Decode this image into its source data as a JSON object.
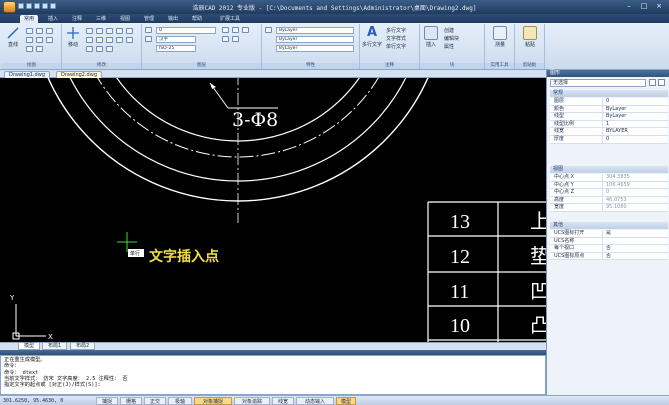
{
  "title": "浩辰CAD 2012 专业版 - [C:\\Documents and Settings\\Administrator\\桌面\\Drawing2.dwg]",
  "ribbon_tabs": [
    "常用",
    "插入",
    "注释",
    "三维",
    "视图",
    "管理",
    "输出",
    "帮助",
    "扩展工具"
  ],
  "active_tab": "常用",
  "ribbon": {
    "draw_group": "绘图",
    "line_btn": "直线",
    "modify_group": "修改",
    "move_btn": "移动",
    "layer_group": "图层",
    "layer_value": "0",
    "color_value": "ByLayer",
    "linetype_value": "ByLayer",
    "lineweight_value": "ByLayer",
    "props_group": "特性",
    "text_style": "汉字",
    "dim_style": "ISO-25",
    "annot_group": "注释",
    "mtext_btn": "多行文字",
    "mtext_style": "多行文字",
    "text_style_btn": "文字样式",
    "single_text": "单行文字",
    "block_group": "块",
    "insert_btn": "插入",
    "create_btn": "创建",
    "edit_block": "编辑块",
    "attr": "属性",
    "utility_group": "实用工具",
    "measure_btn": "测量",
    "clip_btn": "剪贴板",
    "paste_btn": "粘贴"
  },
  "doc_tabs": [
    "Drawing1.dwg",
    "Drawing2.dwg"
  ],
  "canvas": {
    "dim_text": "3-Φ8",
    "insert_label": "文字插入点",
    "cursor_tag": "单行",
    "table_numbers": [
      "13",
      "12",
      "11",
      "10"
    ],
    "table_right": [
      "上",
      "垫",
      "凹",
      "凸"
    ]
  },
  "layout_tabs": [
    "模型",
    "布局1",
    "布局2"
  ],
  "command_lines": [
    "正在重生成模型。",
    "命令：",
    "命令：_dtext",
    "当前文字样式： 仿宋   文字高度： 2.5  注释性： 否",
    "指定文字的起点或 [对正(J)/样式(S)]:"
  ],
  "status": {
    "coords": "301.6250, 95.4630, 0",
    "buttons": [
      "捕捉",
      "栅格",
      "正交",
      "极轴",
      "对象捕捉",
      "对象追踪",
      "线宽",
      "动态输入",
      "模型"
    ],
    "on_buttons": [
      "对象捕捉",
      "模型"
    ]
  },
  "properties": {
    "header": "图形",
    "selection": "无选择",
    "sections": {
      "general": "常规",
      "view": "视图",
      "misc": "其他"
    },
    "general_rows": [
      {
        "k": "图层",
        "v": "0"
      },
      {
        "k": "颜色",
        "v": "ByLayer"
      },
      {
        "k": "线型",
        "v": "ByLayer"
      },
      {
        "k": "线型比例",
        "v": "1"
      },
      {
        "k": "线宽",
        "v": "BYLAYER"
      },
      {
        "k": "厚度",
        "v": "0"
      }
    ],
    "view_rows": [
      {
        "k": "中心点 X",
        "v": "304.3835"
      },
      {
        "k": "中心点 Y",
        "v": "106.4659"
      },
      {
        "k": "中心点 Z",
        "v": "0"
      },
      {
        "k": "高度",
        "v": "46.0753"
      },
      {
        "k": "宽度",
        "v": "95.1080"
      }
    ],
    "misc_rows": [
      {
        "k": "UCS图标打开",
        "v": "是"
      },
      {
        "k": "UCS名称",
        "v": ""
      },
      {
        "k": "每个视口",
        "v": "否"
      },
      {
        "k": "UCS图标原点",
        "v": "否"
      }
    ]
  },
  "colors": {
    "canvas": "#000000",
    "accent_yellow": "#f0e040",
    "cursor_green": "#3ddc3d"
  }
}
